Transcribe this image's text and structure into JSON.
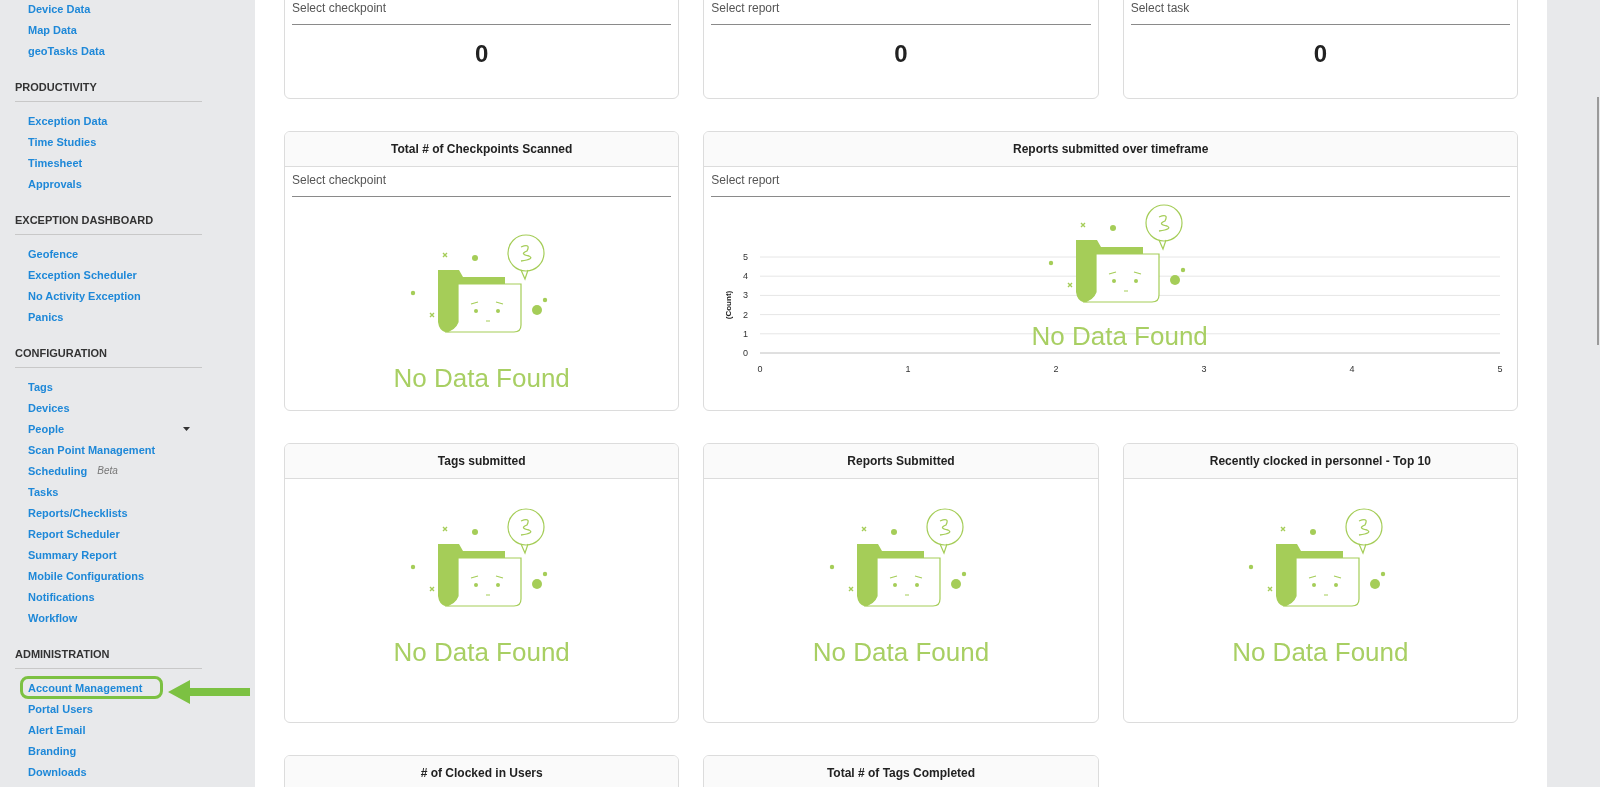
{
  "sidebar": {
    "sections": [
      {
        "items": [
          {
            "label": "Device Data",
            "highlighted": false,
            "expandable": false
          },
          {
            "label": "Map Data",
            "highlighted": false,
            "expandable": false
          },
          {
            "label": "geoTasks Data",
            "highlighted": false,
            "expandable": false
          }
        ]
      },
      {
        "heading": "PRODUCTIVITY",
        "items": [
          {
            "label": "Exception Data",
            "highlighted": false,
            "expandable": false
          },
          {
            "label": "Time Studies",
            "highlighted": false,
            "expandable": false
          },
          {
            "label": "Timesheet",
            "highlighted": false,
            "expandable": false
          },
          {
            "label": "Approvals",
            "highlighted": false,
            "expandable": false
          }
        ]
      },
      {
        "heading": "EXCEPTION DASHBOARD",
        "items": [
          {
            "label": "Geofence",
            "highlighted": false,
            "expandable": false
          },
          {
            "label": "Exception Scheduler",
            "highlighted": false,
            "expandable": false
          },
          {
            "label": "No Activity Exception",
            "highlighted": false,
            "expandable": false
          },
          {
            "label": "Panics",
            "highlighted": false,
            "expandable": false
          }
        ]
      },
      {
        "heading": "CONFIGURATION",
        "items": [
          {
            "label": "Tags",
            "highlighted": false,
            "expandable": false
          },
          {
            "label": "Devices",
            "highlighted": false,
            "expandable": false
          },
          {
            "label": "People",
            "highlighted": false,
            "expandable": true
          },
          {
            "label": "Scan Point Management",
            "highlighted": false,
            "expandable": false
          },
          {
            "label": "Scheduling",
            "badge": "Beta",
            "highlighted": false,
            "expandable": false
          },
          {
            "label": "Tasks",
            "highlighted": false,
            "expandable": false
          },
          {
            "label": "Reports/Checklists",
            "highlighted": false,
            "expandable": false
          },
          {
            "label": "Report Scheduler",
            "highlighted": false,
            "expandable": false
          },
          {
            "label": "Summary Report",
            "highlighted": false,
            "expandable": false
          },
          {
            "label": "Mobile Configurations",
            "highlighted": false,
            "expandable": false
          },
          {
            "label": "Notifications",
            "highlighted": false,
            "expandable": false
          },
          {
            "label": "Workflow",
            "highlighted": false,
            "expandable": false
          }
        ]
      },
      {
        "heading": "ADMINISTRATION",
        "items": [
          {
            "label": "Account Management",
            "highlighted": true,
            "expandable": false
          },
          {
            "label": "Portal Users",
            "highlighted": false,
            "expandable": false
          },
          {
            "label": "Alert Email",
            "highlighted": false,
            "expandable": false
          },
          {
            "label": "Branding",
            "highlighted": false,
            "expandable": false
          },
          {
            "label": "Downloads",
            "highlighted": false,
            "expandable": false
          }
        ]
      }
    ]
  },
  "widgets": [
    {
      "kind": "counter",
      "placeholder": "Select checkpoint",
      "value": "0"
    },
    {
      "kind": "counter",
      "placeholder": "Select report",
      "value": "0"
    },
    {
      "kind": "counter",
      "placeholder": "Select task",
      "value": "0"
    },
    {
      "kind": "empty",
      "title": "Total # of Checkpoints Scanned",
      "placeholder": "Select checkpoint",
      "empty_text": "No Data Found"
    },
    {
      "kind": "chart",
      "title": "Reports submitted over timeframe",
      "placeholder": "Select report",
      "empty_text": "No Data Found",
      "chart_data": {
        "type": "line",
        "grid": true,
        "ylabel": "(Count)",
        "xlim": [
          0,
          5
        ],
        "ylim": [
          0,
          5
        ],
        "xticks": [
          0,
          1,
          2,
          3,
          4,
          5
        ],
        "yticks": [
          0,
          1,
          2,
          3,
          4,
          5
        ]
      }
    },
    {
      "kind": "empty",
      "title": "Tags submitted",
      "empty_text": "No Data Found"
    },
    {
      "kind": "empty",
      "title": "Reports Submitted",
      "empty_text": "No Data Found"
    },
    {
      "kind": "empty",
      "title": "Recently clocked in personnel - Top 10",
      "empty_text": "No Data Found"
    },
    {
      "kind": "header",
      "title": "# of Clocked in Users"
    },
    {
      "kind": "header",
      "title": "Total # of Tags Completed"
    }
  ]
}
